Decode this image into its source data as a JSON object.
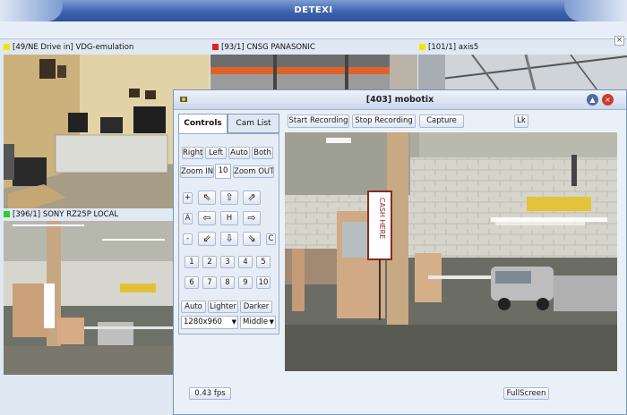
{
  "window": {
    "title": "DETEXI",
    "close": "×"
  },
  "cameras": [
    {
      "label": "[49/NE Drive in] VDG-emulation",
      "indicator": "#f2e600"
    },
    {
      "label": "[93/1] CNSG PANASONIC",
      "indicator": "#e02020"
    },
    {
      "label": "[101/1] axis5",
      "indicator": "#f2e600"
    },
    {
      "label": "[396/1] SONY RZ25P LOCAL",
      "indicator": "#2ad32a"
    }
  ],
  "viewer": {
    "title": "[403] mobotix",
    "tabs": {
      "controls": "Controls",
      "cam_list": "Cam List"
    },
    "toolbar": {
      "start": "Start Recording",
      "stop": "Stop Recording",
      "capture": "Capture",
      "lk": "Lk"
    },
    "ptz": {
      "right": "Right",
      "left": "Left",
      "auto": "Auto",
      "both": "Both",
      "zoom_in": "Zoom IN",
      "zoom_value": "10",
      "zoom_out": "Zoom OUT",
      "plus": "+",
      "a": "A",
      "minus": "-",
      "h": "H",
      "c": "C"
    },
    "presets": [
      "1",
      "2",
      "3",
      "4",
      "5",
      "6",
      "7",
      "8",
      "9",
      "10"
    ],
    "image": {
      "auto": "Auto",
      "lighter": "Lighter",
      "darker": "Darker"
    },
    "resolution": "1280x960",
    "quality": "Middle",
    "fps": "0.43 fps",
    "fullscreen": "FullScreen",
    "sign_text": "CASH HERE"
  }
}
